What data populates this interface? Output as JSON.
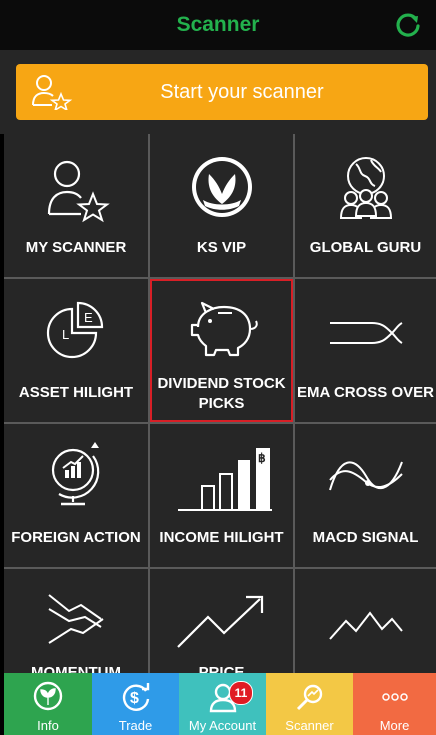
{
  "header": {
    "title": "Scanner",
    "refresh_icon": "refresh-icon"
  },
  "start": {
    "label": "Start your scanner",
    "icon": "user-star-icon"
  },
  "colors": {
    "accent_green": "#23b14d",
    "start_orange": "#f7a614",
    "selected_border": "#d81f26"
  },
  "tiles": [
    {
      "label": "MY SCANNER",
      "icon": "user-star-icon"
    },
    {
      "label": "KS VIP",
      "icon": "ks-logo-icon"
    },
    {
      "label": "GLOBAL GURU",
      "icon": "globe-people-icon"
    },
    {
      "label": "ASSET HILIGHT",
      "icon": "pie-chart-icon"
    },
    {
      "label": "DIVIDEND STOCK PICKS",
      "icon": "piggy-bank-icon",
      "selected": true
    },
    {
      "label": "EMA CROSS OVER",
      "icon": "cross-lines-icon"
    },
    {
      "label": "FOREIGN ACTION",
      "icon": "globe-chart-icon"
    },
    {
      "label": "INCOME HILIGHT",
      "icon": "bar-chart-baht-icon"
    },
    {
      "label": "MACD SIGNAL",
      "icon": "wave-icon"
    },
    {
      "label": "MOMENTUM",
      "icon": "momentum-icon"
    },
    {
      "label": "PRICE",
      "icon": "trend-up-icon"
    },
    {
      "label": "",
      "icon": "zigzag-icon"
    }
  ],
  "tabs": [
    {
      "label": "Info",
      "color": "#2ea44f",
      "icon": "info-plant-icon"
    },
    {
      "label": "Trade",
      "color": "#2f9be8",
      "icon": "trade-dollar-icon"
    },
    {
      "label": "My Account",
      "color": "#3fc1bd",
      "icon": "account-icon",
      "badge": "11"
    },
    {
      "label": "Scanner",
      "color": "#f3c845",
      "icon": "scanner-search-icon"
    },
    {
      "label": "More",
      "color": "#f26a42",
      "icon": "more-dots-icon"
    }
  ]
}
